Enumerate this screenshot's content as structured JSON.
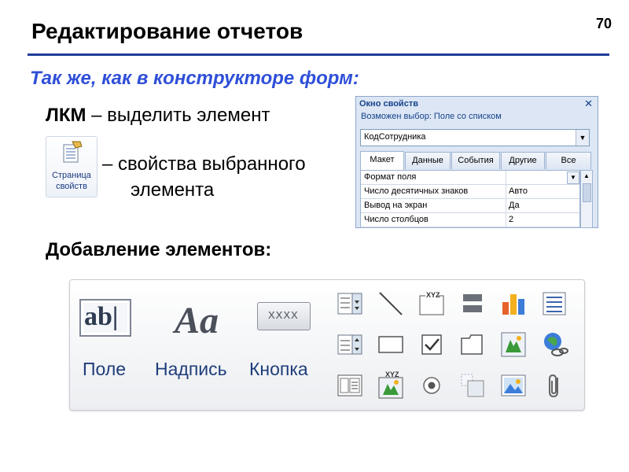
{
  "slide": {
    "title": "Редактирование отчетов",
    "page_number": "70",
    "subtitle": "Так же, как в конструкторе форм:",
    "lkm_key": "ЛКМ",
    "lkm_text": " – выделить  элемент",
    "props_line1": "– свойства выбранного",
    "props_line2": "элемента",
    "add_title": "Добавление элементов:"
  },
  "property_button": {
    "label_line1": "Страница",
    "label_line2": "свойств",
    "icon": "property-sheet-icon"
  },
  "property_window": {
    "title": "Окно свойств",
    "selection_label": "Возможен выбор:  Поле со списком",
    "combo_value": "КодСотрудника",
    "tabs": [
      "Макет",
      "Данные",
      "События",
      "Другие",
      "Все"
    ],
    "active_tab": "Макет",
    "rows": [
      {
        "name": "Формат поля",
        "value": ""
      },
      {
        "name": "Число десятичных знаков",
        "value": "Авто"
      },
      {
        "name": "Вывод на экран",
        "value": "Да"
      },
      {
        "name": "Число столбцов",
        "value": "2"
      }
    ]
  },
  "toolbar": {
    "big_controls": [
      {
        "label": "Поле",
        "icon_text": "ab|",
        "icon": "textbox-icon"
      },
      {
        "label": "Надпись",
        "icon_text": "Aa",
        "icon": "label-icon"
      },
      {
        "label": "Кнопка",
        "icon_text": "XXXX",
        "icon": "button-icon"
      }
    ],
    "small_icons": [
      "combobox-icon",
      "line-icon",
      "option-group-icon",
      "page-break-icon",
      "chart-icon",
      "list-icon",
      "listbox-icon",
      "rectangle-icon",
      "checkbox-icon",
      "tab-control-icon",
      "unbound-object-icon",
      "hyperlink-icon",
      "subform-icon",
      "bound-object-icon",
      "option-button-icon",
      "toggle-icon",
      "image-icon",
      "attachment-icon"
    ],
    "option_group_text": "XYZ",
    "bound_object_text": "XYZ"
  },
  "colors": {
    "title_rule": "#1f3c99",
    "subtitle": "#2f4fd8",
    "toolbar_label": "#1e3d7a"
  }
}
